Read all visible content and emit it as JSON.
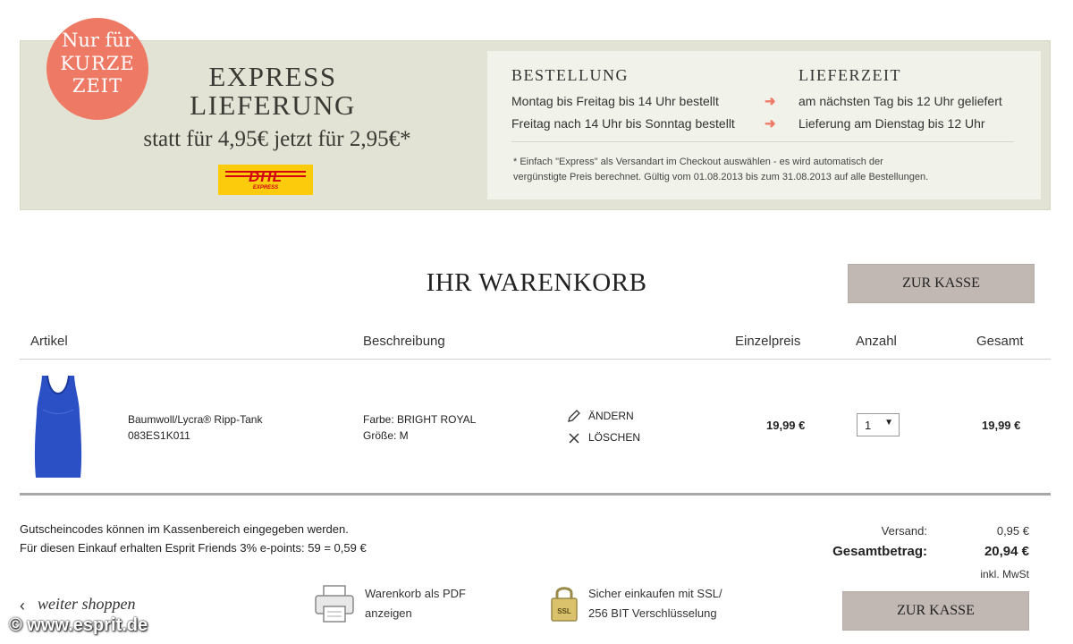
{
  "banner": {
    "badge": [
      "Nur für",
      "KURZE",
      "ZEIT"
    ],
    "title_line1": "EXPRESS",
    "title_line2": "LIEFERUNG",
    "price_text": "statt für 4,95€ jetzt für 2,95€*",
    "dhl_logo": "DHL",
    "dhl_sub": "EXPRESS",
    "col1_title": "BESTELLUNG",
    "col2_title": "LIEFERZEIT",
    "rows": [
      {
        "order": "Montag bis Freitag bis 14 Uhr bestellt",
        "delivery": "am nächsten Tag bis 12 Uhr geliefert"
      },
      {
        "order": "Freitag nach 14 Uhr bis Sonntag bestellt",
        "delivery": "Lieferung am Dienstag bis 12 Uhr"
      }
    ],
    "arrow_icon": "arrow-right-icon",
    "footnote_line1": "* Einfach \"Express\" als Versandart im Checkout auswählen - es wird automatisch der",
    "footnote_line2": "vergünstigte Preis berechnet. Gültig vom 01.08.2013 bis zum 31.08.2013 auf alle Bestellungen.",
    "accent_color": "#ee7a65"
  },
  "cart": {
    "title": "IHR WARENKORB",
    "checkout_label": "ZUR KASSE",
    "columns": [
      "Artikel",
      "Beschreibung",
      "Einzelpreis",
      "Anzahl",
      "Gesamt"
    ],
    "items": [
      {
        "name": "Baumwoll/Lycra® Ripp-Tank",
        "sku": "083ES1K011",
        "color_line": "Farbe: BRIGHT ROYAL",
        "size_line": "Größe: M",
        "edit_label": "ÄNDERN",
        "delete_label": "LÖSCHEN",
        "unit_price": "19,99 €",
        "quantity": "1",
        "total": "19,99 €",
        "product_color": "#2b4fc4"
      }
    ]
  },
  "footer": {
    "voucher_note": "Gutscheincodes können im Kassenbereich eingegeben werden.",
    "points_note": "Für diesen Einkauf erhalten Esprit Friends 3% e-points: 59 = 0,59 €",
    "shipping_label": "Versand:",
    "shipping_value": "0,95 €",
    "total_label": "Gesamtbetrag:",
    "total_value": "20,94 €",
    "vat_note": "inkl. MwSt",
    "continue_label": "weiter shoppen",
    "pdf_label_line1": "Warenkorb als PDF",
    "pdf_label_line2": "anzeigen",
    "ssl_label_line1": "Sicher einkaufen mit SSL/",
    "ssl_label_line2": "256 BIT Verschlüsselung",
    "ssl_badge": "SSL",
    "checkout_label": "ZUR KASSE",
    "watermark": "© www.esprit.de"
  }
}
